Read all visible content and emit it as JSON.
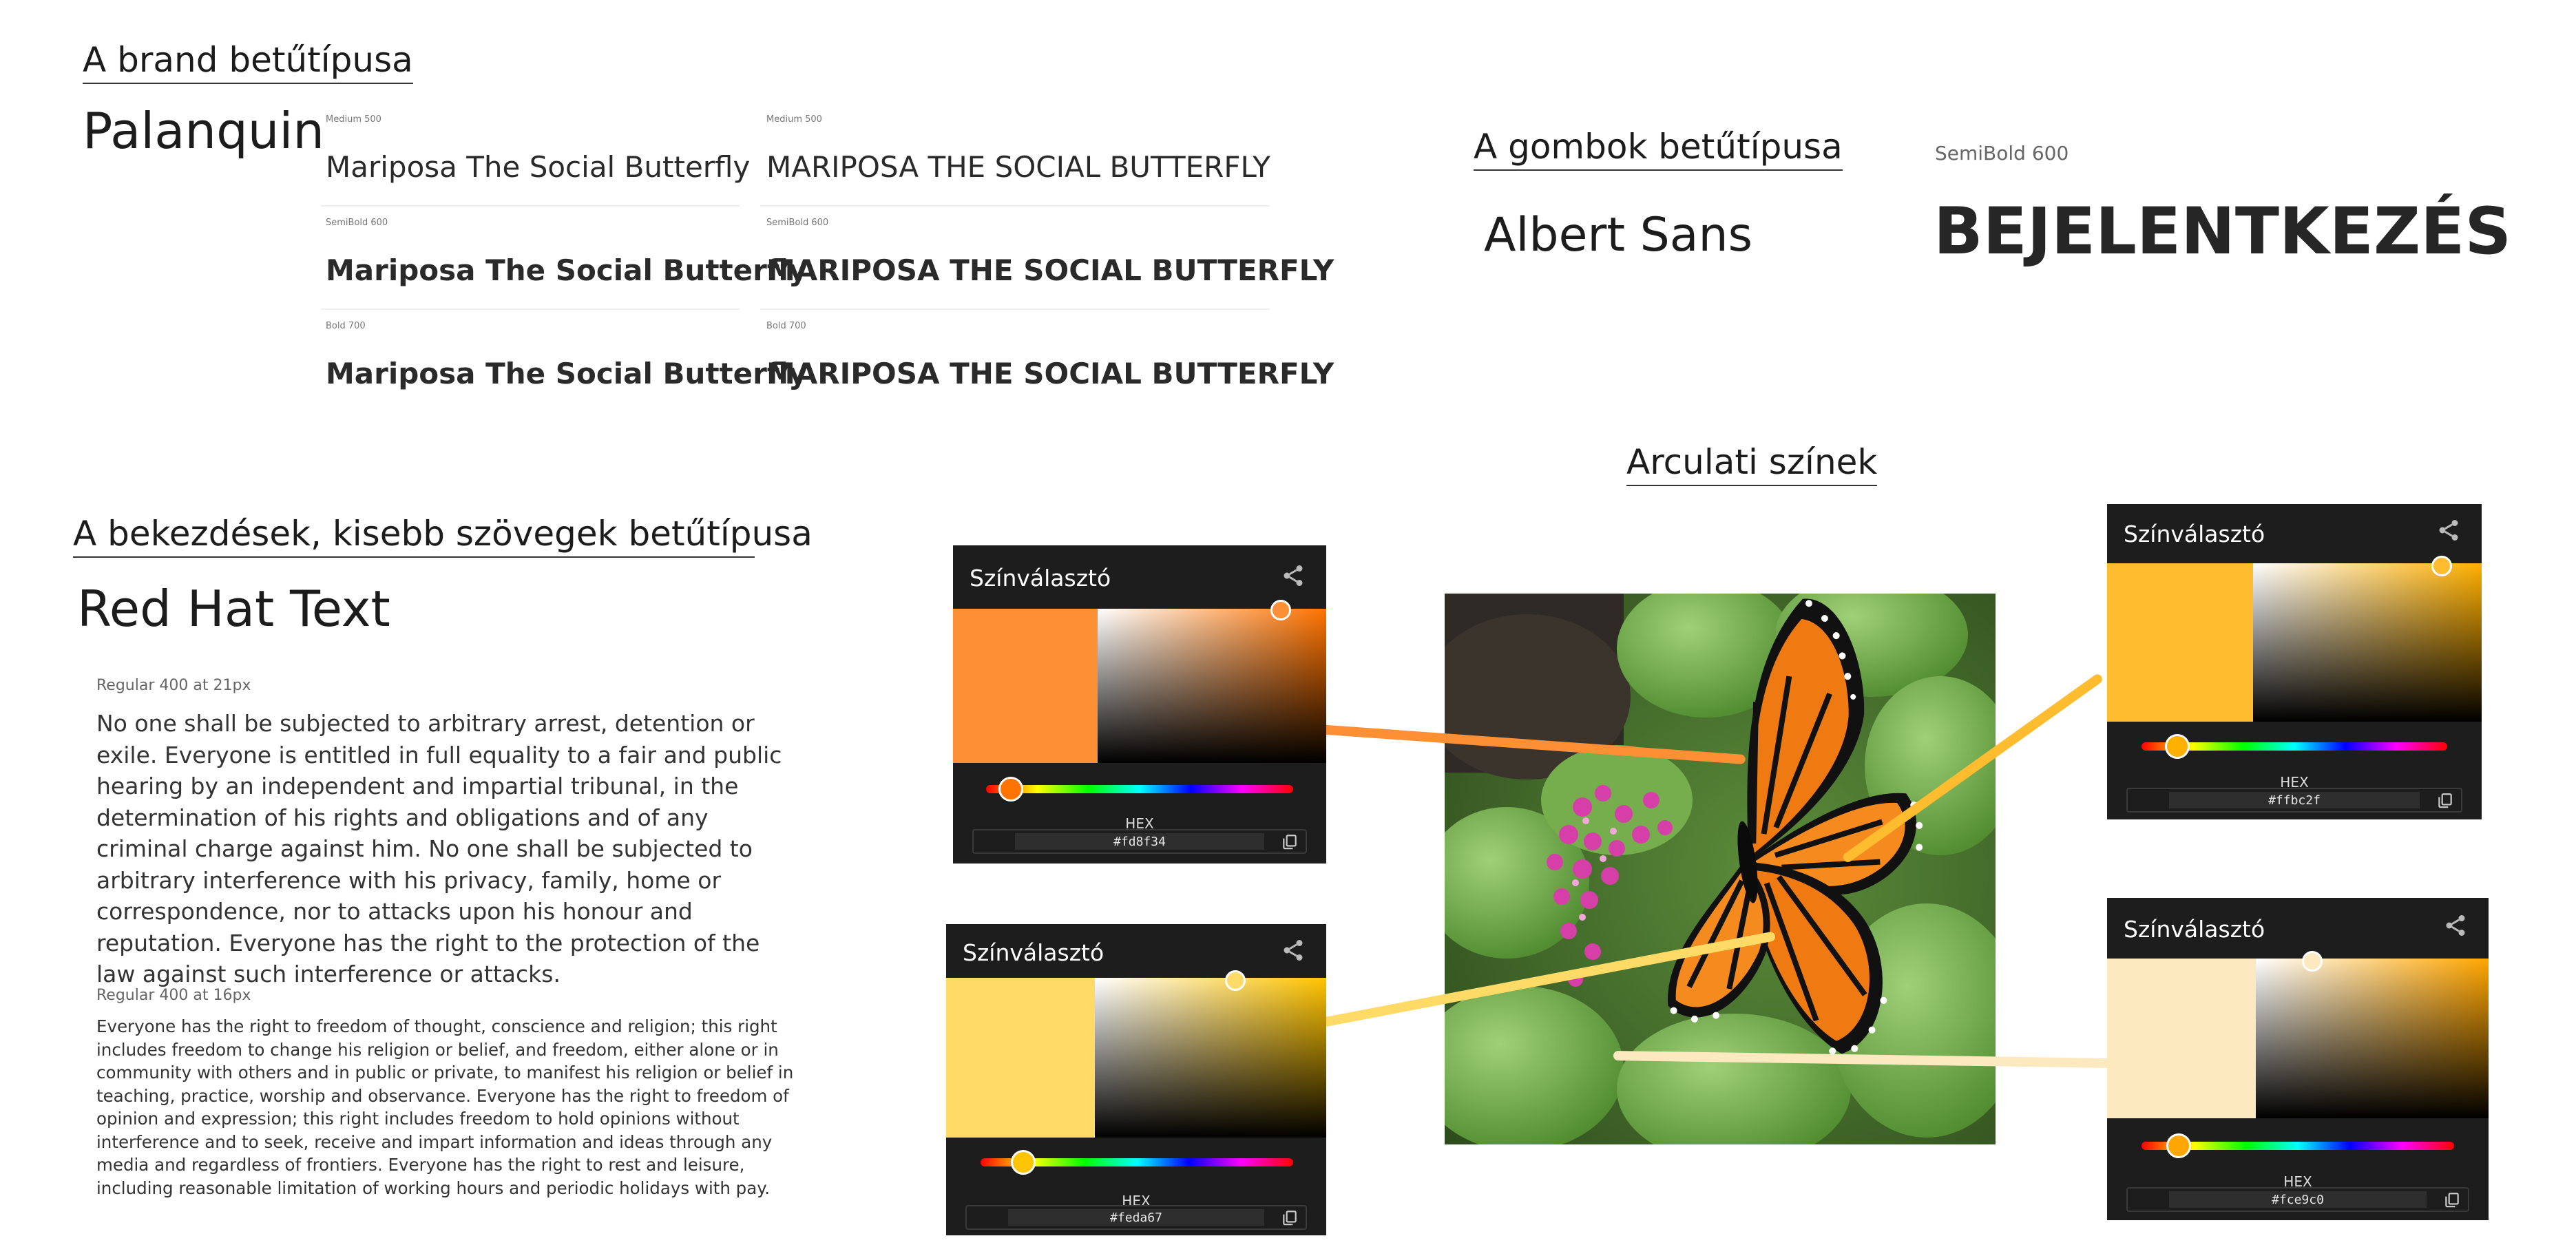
{
  "brand": {
    "heading": "A brand betűtípusa",
    "font_name": "Palanquin",
    "samples": [
      {
        "weight_label": "Medium 500",
        "text": "Mariposa The Social Butterfly",
        "upper_label": "Medium 500",
        "upper_text": "MARIPOSA THE SOCIAL BUTTERFLY"
      },
      {
        "weight_label": "SemiBold 600",
        "text": "Mariposa The Social Butterfly",
        "upper_label": "SemiBold 600",
        "upper_text": "MARIPOSA THE SOCIAL BUTTERFLY"
      },
      {
        "weight_label": "Bold 700",
        "text": "Mariposa The Social Butterfly",
        "upper_label": "Bold 700",
        "upper_text": "MARIPOSA THE SOCIAL BUTTERFLY"
      }
    ]
  },
  "buttons": {
    "heading": "A gombok betűtípusa",
    "font_name": "Albert Sans",
    "weight_label": "SemiBold 600",
    "sample": "BEJELENTKEZÉS"
  },
  "body": {
    "heading": "A bekezdések, kisebb szövegek betűtípusa",
    "font_name": "Red Hat Text",
    "large_label": "Regular 400 at 21px",
    "large_text": "No one shall be subjected to arbitrary arrest, detention or exile. Everyone is entitled in full equality to a fair and public hearing by an independent and impartial tribunal, in the determination of his rights and obligations and of any criminal charge against him. No one shall be subjected to arbitrary interference with his privacy, family, home or correspondence, nor to attacks upon his honour and reputation. Everyone has the right to the protection of the law against such interference or attacks.",
    "small_label": "Regular 400 at 16px",
    "small_text": "Everyone has the right to freedom of thought, conscience and religion; this right includes freedom to change his religion or belief, and freedom, either alone or in community with others and in public or private, to manifest his religion or belief in teaching, practice, worship and observance. Everyone has the right to freedom of opinion and expression; this right includes freedom to hold opinions without interference and to seek, receive and impart information and ideas through any media and regardless of frontiers. Everyone has the right to rest and leisure, including reasonable limitation of working hours and periodic holidays with pay."
  },
  "colors": {
    "heading": "Arculati színek",
    "pickers": [
      {
        "title": "Színválasztó",
        "hex_label": "HEX",
        "hex": "#fd8f34",
        "hue": "#ff7300",
        "hue_position": 0.07
      },
      {
        "title": "Színválasztó",
        "hex_label": "HEX",
        "hex": "#feda67",
        "hue": "#ffc400",
        "hue_position": 0.13
      },
      {
        "title": "Színválasztó",
        "hex_label": "HEX",
        "hex": "#ffbc2f",
        "hue": "#ffb000",
        "hue_position": 0.12
      },
      {
        "title": "Színválasztó",
        "hex_label": "HEX",
        "hex": "#fce9c0",
        "hue": "#ffa600",
        "hue_position": 0.12
      }
    ]
  },
  "icons": {
    "share": "share-icon",
    "copy": "copy-icon",
    "photo": "butterfly-photo"
  }
}
